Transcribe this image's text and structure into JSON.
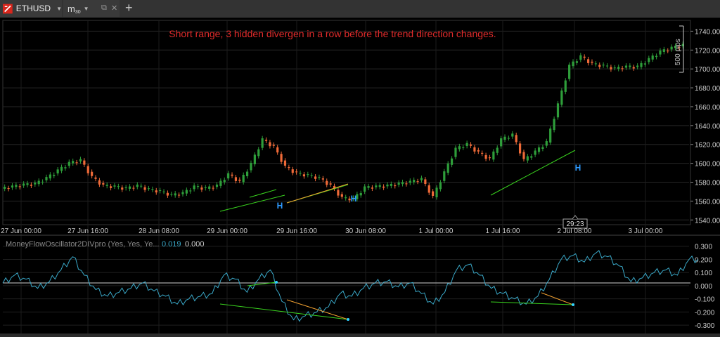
{
  "tabs": [
    {
      "symbol": "ETHUSD",
      "icon": "brand-logo-icon"
    },
    {
      "timeframe_letter": "m",
      "timeframe_number": "30",
      "icons": [
        "external-link-icon",
        "close-icon"
      ]
    }
  ],
  "annotation": "Short range, 3 hidden divergen in a row before the trend direction changes.",
  "measure_label": "500 pips",
  "countdown": "29:23",
  "divergence_markers": [
    "H",
    "H",
    "H"
  ],
  "indicator": {
    "name": "MoneyFlowOscillator2DIVpro (Yes, Yes, Ye...",
    "value1": "0.019",
    "value2": "0.000"
  },
  "colors": {
    "bull": "#2e9e3a",
    "bear": "#ef6a38",
    "annotation": "#e02b2b",
    "marker": "#2f9bff",
    "osc": "#3aa9c9",
    "trend_green": "#39d31e",
    "trend_orange": "#f0a030"
  },
  "chart_data": [
    {
      "type": "candlestick",
      "symbol": "ETHUSD",
      "timeframe": "m30",
      "x_labels": [
        "27 Jun 00:00",
        "27 Jun 16:00",
        "28 Jun 08:00",
        "29 Jun 00:00",
        "29 Jun 16:00",
        "30 Jun 08:00",
        "1 Jul 00:00",
        "1 Jul 16:00",
        "2 Jul 08:00",
        "3 Jul 00:00"
      ],
      "y_ticks": [
        "1740.00",
        "1720.00",
        "1700.00",
        "1680.00",
        "1660.00",
        "1640.00",
        "1620.00",
        "1600.00",
        "1580.00",
        "1560.00",
        "1540.00"
      ],
      "ylim": [
        1535,
        1747
      ],
      "series": [
        {
          "values": [
            1575,
            1577,
            1578,
            1584,
            1592,
            1600,
            1603,
            1585,
            1576,
            1575,
            1573,
            1576,
            1572,
            1570,
            1566,
            1568,
            1575,
            1573,
            1576,
            1588,
            1580,
            1599,
            1625,
            1617,
            1596,
            1589,
            1587,
            1584,
            1576,
            1563,
            1562,
            1574,
            1575,
            1576,
            1578,
            1580,
            1583,
            1564,
            1590,
            1615,
            1620,
            1611,
            1604,
            1625,
            1630,
            1603,
            1612,
            1622,
            1662,
            1703,
            1713,
            1705,
            1703,
            1700,
            1702,
            1702,
            1710,
            1718,
            1722,
            1725
          ]
        }
      ]
    },
    {
      "type": "line",
      "name": "MoneyFlowOscillator2DIVpro",
      "y_ticks": [
        "0.300",
        "0.200",
        "0.100",
        "0.000",
        "-0.100",
        "-0.200",
        "-0.300"
      ],
      "ylim": [
        -0.31,
        0.32
      ],
      "series": [
        {
          "values": [
            0.02,
            0.08,
            0.05,
            -0.02,
            0.03,
            0.12,
            0.22,
            0.08,
            -0.03,
            -0.08,
            -0.05,
            -0.02,
            0.02,
            -0.04,
            -0.08,
            -0.14,
            -0.1,
            -0.08,
            -0.06,
            0.08,
            0.05,
            -0.05,
            0.05,
            0.12,
            -0.12,
            -0.26,
            -0.23,
            -0.2,
            -0.16,
            -0.06,
            -0.08,
            -0.02,
            0.02,
            0.03,
            -0.01,
            0.02,
            -0.06,
            -0.14,
            -0.05,
            0.12,
            0.16,
            0.08,
            -0.02,
            -0.06,
            -0.1,
            -0.14,
            -0.08,
            0.05,
            0.2,
            0.23,
            0.18,
            0.25,
            0.22,
            0.15,
            0.03,
            0.06,
            0.1,
            0.12,
            0.08,
            0.2
          ]
        }
      ]
    }
  ]
}
